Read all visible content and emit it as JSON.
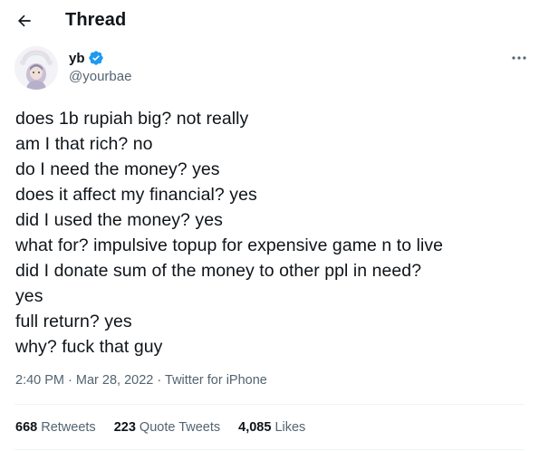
{
  "header": {
    "title": "Thread",
    "back_icon": "arrow-left-icon"
  },
  "author": {
    "name": "yb",
    "handle": "@yourbae",
    "verified": true,
    "verified_color": "#1d9bf0",
    "avatar_icon": "avatar-image"
  },
  "more_icon": "more-horizontal-icon",
  "tweet": {
    "lines": [
      "does 1b rupiah big? not really",
      "am I that rich? no",
      "do I need the money? yes",
      "does it affect my financial? yes",
      "did I used the money? yes",
      "what for? impulsive topup for expensive game n to live",
      "did I donate sum of the money to other ppl in need?",
      "yes",
      "full return? yes",
      "why? fuck that guy"
    ]
  },
  "meta": {
    "time": "2:40 PM",
    "separator": "·",
    "date": "Mar 28, 2022",
    "source": "Twitter for iPhone"
  },
  "stats": {
    "retweets": {
      "count": "668",
      "label": "Retweets"
    },
    "quote_tweets": {
      "count": "223",
      "label": "Quote Tweets"
    },
    "likes": {
      "count": "4,085",
      "label": "Likes"
    }
  },
  "colors": {
    "text": "#0f1419",
    "secondary": "#536471",
    "divider": "#eff3f4",
    "accent": "#1d9bf0"
  }
}
